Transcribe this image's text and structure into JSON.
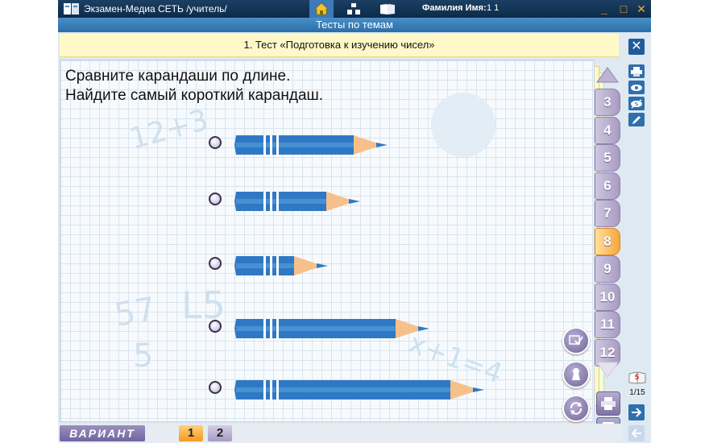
{
  "window": {
    "app_title": "Экзамен-Медиа СЕТЬ /учитель/",
    "user_label": "Фамилия Имя:",
    "user_value": "1 1",
    "controls": [
      "_",
      "□",
      "✕"
    ]
  },
  "section_title": "Тесты по темам",
  "test_title": "1. Тест «Подготовка к изучению чисел»",
  "question": {
    "line1": "Сравните карандаши по длине.",
    "line2": "Найдите самый короткий карандаш."
  },
  "answers": [
    {
      "id": "a1",
      "pencil_length": 190
    },
    {
      "id": "a2",
      "pencil_length": 156
    },
    {
      "id": "a3",
      "pencil_length": 116
    },
    {
      "id": "a4",
      "pencil_length": 242
    },
    {
      "id": "a5",
      "pencil_length": 310
    }
  ],
  "question_tabs": [
    "3",
    "4",
    "5",
    "6",
    "7",
    "8",
    "9",
    "10",
    "11",
    "12"
  ],
  "active_tab": "8",
  "page_counter": "1/15",
  "variant": {
    "label": "ВАРИАНТ",
    "options": [
      "1",
      "2"
    ],
    "active": "1"
  },
  "colors": {
    "pencil_body": "#2f79c4",
    "pencil_stripe": "#ffffff",
    "pencil_wood": "#f7c08a",
    "accent_orange": "#f39a23",
    "tab_purple": "#a89bc3"
  }
}
